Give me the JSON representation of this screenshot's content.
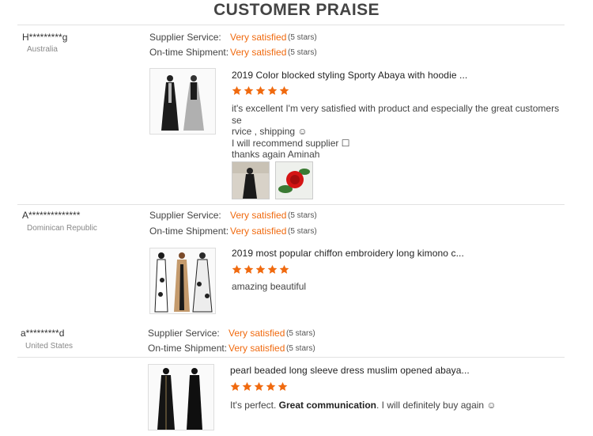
{
  "page": {
    "title": "CUSTOMER PRAISE"
  },
  "colors": {
    "accent": "#f06a0f",
    "star": "#f06a0f"
  },
  "reviews": [
    {
      "user": "H*********g",
      "country": "Australia",
      "supplier_label": "Supplier Service:",
      "supplier_value": "Very satisfied",
      "supplier_stars": "(5 stars)",
      "shipment_label": "On-time Shipment:",
      "shipment_value": "Very satisfied",
      "shipment_stars": "(5 stars)",
      "product_title": "2019 Color blocked styling Sporty Abaya with hoodie ...",
      "rating": 5,
      "comment_lines": [
        "it's excellent I'm very satisfied with product and especially the great customers se",
        "rvice , shipping ☺",
        "I will recommend supplier ☐",
        "thanks again Aminah"
      ],
      "photos": [
        "abaya-photo",
        "rose-photo"
      ]
    },
    {
      "user": "A**************",
      "country": "Dominican Republic",
      "supplier_label": "Supplier Service:",
      "supplier_value": "Very satisfied",
      "supplier_stars": "(5 stars)",
      "shipment_label": "On-time Shipment:",
      "shipment_value": "Very satisfied",
      "shipment_stars": "(5 stars)",
      "product_title": "2019 most popular chiffon embroidery long kimono c...",
      "rating": 5,
      "comment_lines": [
        "amazing beautiful"
      ]
    },
    {
      "user": "a*********d",
      "country": "United States",
      "supplier_label": "Supplier Service:",
      "supplier_value": "Very satisfied",
      "supplier_stars": "(5 stars)",
      "shipment_label": "On-time Shipment:",
      "shipment_value": "Very satisfied",
      "shipment_stars": "(5 stars)",
      "product_title": "pearl beaded long sleeve dress muslim opened abaya...",
      "rating": 5,
      "comment_pre": "It's perfect. ",
      "comment_bold": "Great communication",
      "comment_post": ". I will definitely buy again ☺"
    }
  ]
}
